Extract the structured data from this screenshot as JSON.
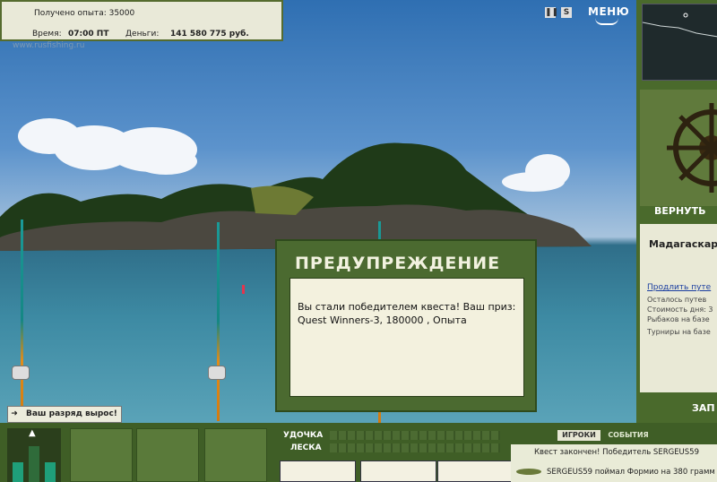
{
  "top_bar": {
    "experience_text": "Получено опыта: 35000",
    "time_label": "Время:",
    "time_value": "07:00 ПТ",
    "money_label": "Деньги:",
    "money_value": "141 580 775 руб.",
    "watermark": "www.rusfishing.ru"
  },
  "top_right": {
    "pause_icon": "pause-icon",
    "sound_label": "S",
    "menu_label": "МЕНЮ"
  },
  "right_panel": {
    "return_label": "ВЕРНУТЬ",
    "location": "Мадагаскар",
    "extend_link": "Продлить путе",
    "lines": [
      "Осталось путев",
      "Стоимость дня: 3",
      "Рыбаков на базе",
      "Турниры на базе"
    ],
    "exit_label": "ЗАП"
  },
  "dialog": {
    "title": "ПРЕДУПРЕЖДЕНИЕ",
    "message_line1": "Вы стали победителем квеста! Ваш приз:",
    "message_line2": "Quest Winners-3, 180000 , Опыта"
  },
  "toast": {
    "icon": "arrow-right-icon",
    "text": "Ваш разряд вырос!"
  },
  "params": {
    "rod_label": "УДОЧКА",
    "line_label": "ЛЕСКА"
  },
  "tabs": {
    "players": "ИГРОКИ",
    "events": "СОБЫТИЯ"
  },
  "log": {
    "line1": "Квест закончен! Победитель SERGEUS59",
    "line2": "SERGEUS59 поймал Формио на 380 грамм"
  },
  "colors": {
    "panel_green": "#4b6a30",
    "dialog_bg": "#f3f1de",
    "link_blue": "#1b3ea0"
  }
}
